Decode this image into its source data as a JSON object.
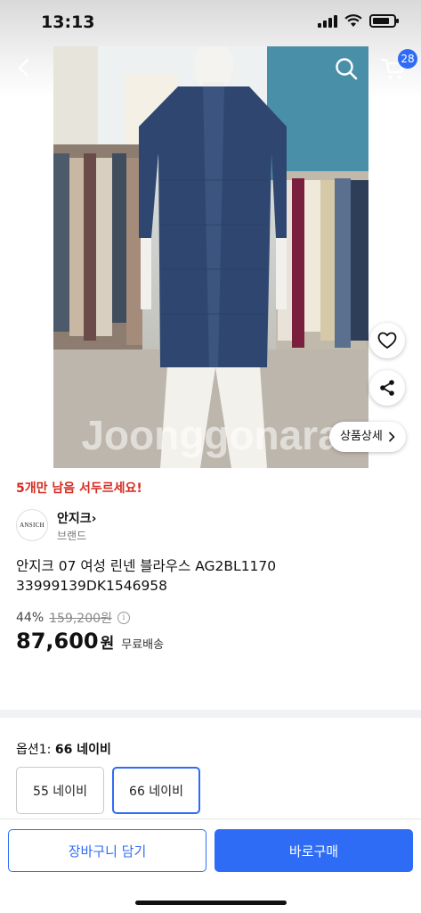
{
  "status_bar": {
    "time": "13:13"
  },
  "header": {
    "cart_count": "28",
    "icons": [
      "back-icon",
      "search-icon",
      "cart-icon"
    ]
  },
  "image": {
    "watermark": "Joonggonara",
    "detail_button": "상품상세"
  },
  "product": {
    "stock_alert": "5개만 남음 서두르세요!",
    "brand_name": "안지크",
    "brand_logo_text": "ANSICH",
    "brand_sub": "브랜드",
    "title": "안지크 07 여성 린넨 블라우스 AG2BL1170 33999139DK1546958",
    "discount": "44%",
    "original_price": "159,200원",
    "sale_price": "87,600",
    "currency": "원",
    "shipping": "무료배송"
  },
  "options": {
    "label_prefix": "옵션1: ",
    "selected": "66 네이비",
    "items": [
      "55 네이비",
      "66 네이비"
    ]
  },
  "actions": {
    "add_to_cart": "장바구니 담기",
    "buy_now": "바로구매"
  },
  "colors": {
    "accent": "#2f6cf6",
    "alert": "#d62b21"
  }
}
